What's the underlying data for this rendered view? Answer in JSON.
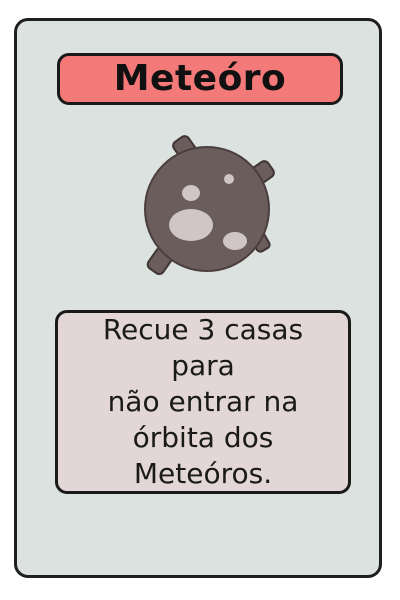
{
  "card": {
    "title": "Meteóro",
    "description": "Recue 3 casas para\nnão entrar na\nórbita dos\nMeteóros.",
    "image_icon": "meteor-icon"
  },
  "colors": {
    "card_background": "#dbe2df",
    "title_banner": "#f47979",
    "text_box": "#e2d7d6",
    "meteor_body": "#6a5d5c",
    "meteor_crater": "#cfc6c5"
  }
}
